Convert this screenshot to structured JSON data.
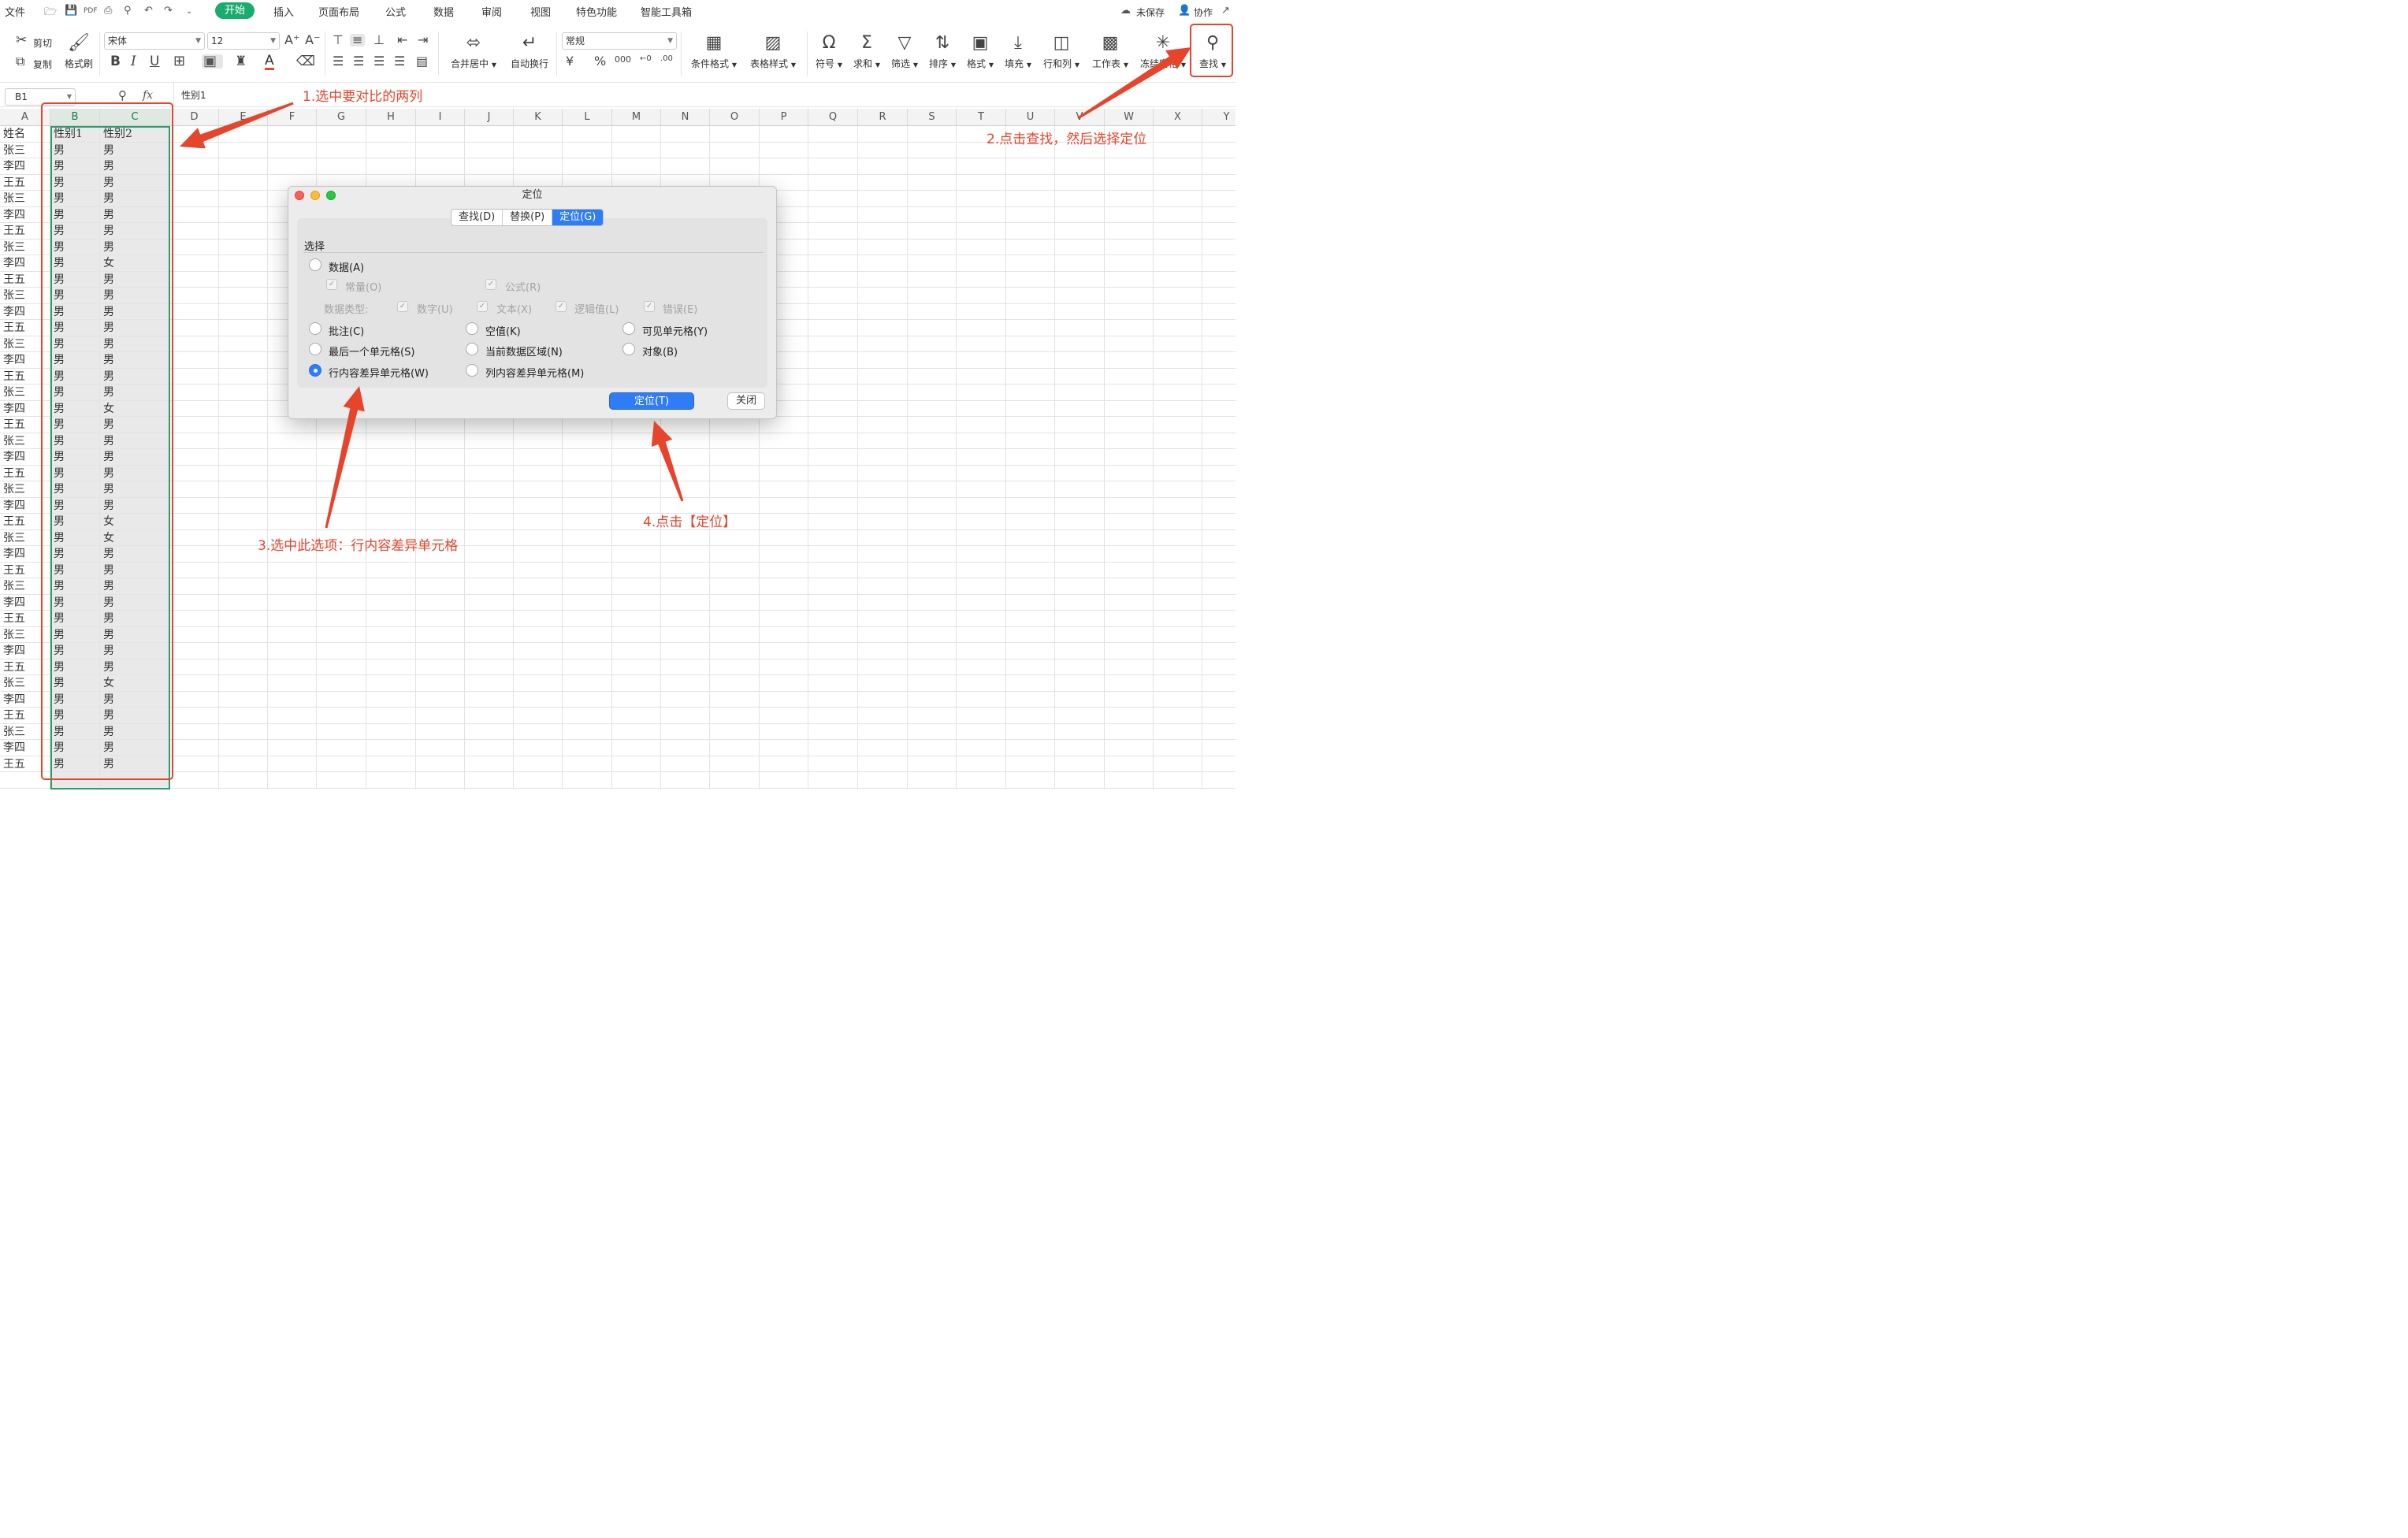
{
  "menu": {
    "file": "文件",
    "tabs": [
      "开始",
      "插入",
      "页面布局",
      "公式",
      "数据",
      "审阅",
      "视图",
      "特色功能",
      "智能工具箱"
    ],
    "unsaved": "未保存",
    "collab": "协作"
  },
  "ribbon": {
    "cut": "剪切",
    "copy": "复制",
    "format_painter": "格式刷",
    "font_name": "宋体",
    "font_size": "12",
    "merge_center": "合并居中",
    "wrap": "自动换行",
    "number_format": "常规",
    "cond_format": "条件格式",
    "table_style": "表格样式",
    "symbol": "符号",
    "sum": "求和",
    "filter": "筛选",
    "sort": "排序",
    "format": "格式",
    "fill": "填充",
    "rowcol": "行和列",
    "worksheet": "工作表",
    "freeze": "冻结窗格",
    "find": "查找"
  },
  "formula_bar": {
    "cell_ref": "B1",
    "fx": "fx",
    "content": "性别1"
  },
  "columns": [
    "A",
    "B",
    "C",
    "D",
    "E",
    "F",
    "G",
    "H",
    "I",
    "J",
    "K",
    "L",
    "M",
    "N",
    "O",
    "P",
    "Q",
    "R",
    "S",
    "T",
    "U",
    "V",
    "W",
    "X",
    "Y"
  ],
  "sheet": {
    "headers": [
      "姓名",
      "性别1",
      "性别2"
    ],
    "names": [
      "张三",
      "李四",
      "王五",
      "张三",
      "李四",
      "王五",
      "张三",
      "李四",
      "王五",
      "张三",
      "李四",
      "王五",
      "张三",
      "李四",
      "王五",
      "张三",
      "李四",
      "王五",
      "张三",
      "李四",
      "王五",
      "张三",
      "李四",
      "王五",
      "张三",
      "李四",
      "王五",
      "张三",
      "李四",
      "王五",
      "张三",
      "李四",
      "王五",
      "张三",
      "李四",
      "王五",
      "张三",
      "李四",
      "王五"
    ],
    "col_b": [
      "男",
      "男",
      "男",
      "男",
      "男",
      "男",
      "男",
      "男",
      "男",
      "男",
      "男",
      "男",
      "男",
      "男",
      "男",
      "男",
      "男",
      "男",
      "男",
      "男",
      "男",
      "男",
      "男",
      "男",
      "男",
      "男",
      "男",
      "男",
      "男",
      "男",
      "男",
      "男",
      "男",
      "男",
      "男",
      "男",
      "男",
      "男",
      "男"
    ],
    "col_c": [
      "男",
      "男",
      "男",
      "男",
      "男",
      "男",
      "男",
      "女",
      "男",
      "男",
      "男",
      "男",
      "男",
      "男",
      "男",
      "男",
      "女",
      "男",
      "男",
      "男",
      "男",
      "男",
      "男",
      "女",
      "女",
      "男",
      "男",
      "男",
      "男",
      "男",
      "男",
      "男",
      "男",
      "女",
      "男",
      "男",
      "男",
      "男",
      "男"
    ]
  },
  "dialog": {
    "title": "定位",
    "tabs": [
      "查找(D)",
      "替换(P)",
      "定位(G)"
    ],
    "section": "选择",
    "data": "数据(A)",
    "constant": "常量(O)",
    "formula": "公式(R)",
    "datatype": "数据类型:",
    "number": "数字(U)",
    "text": "文本(X)",
    "logical": "逻辑值(L)",
    "error": "错误(E)",
    "comment": "批注(C)",
    "blank": "空值(K)",
    "visible": "可见单元格(Y)",
    "last_cell": "最后一个单元格(S)",
    "current_region": "当前数据区域(N)",
    "objects": "对象(B)",
    "row_diff": "行内容差异单元格(W)",
    "col_diff": "列内容差异单元格(M)",
    "locate_button": "定位(T)",
    "close_button": "关闭"
  },
  "annotations": {
    "step1": "1.选中要对比的两列",
    "step2": "2.点击查找，然后选择定位",
    "step3": "3.选中此选项：行内容差异单元格",
    "step4": "4.点击【定位】",
    "color": "#e6442b"
  }
}
